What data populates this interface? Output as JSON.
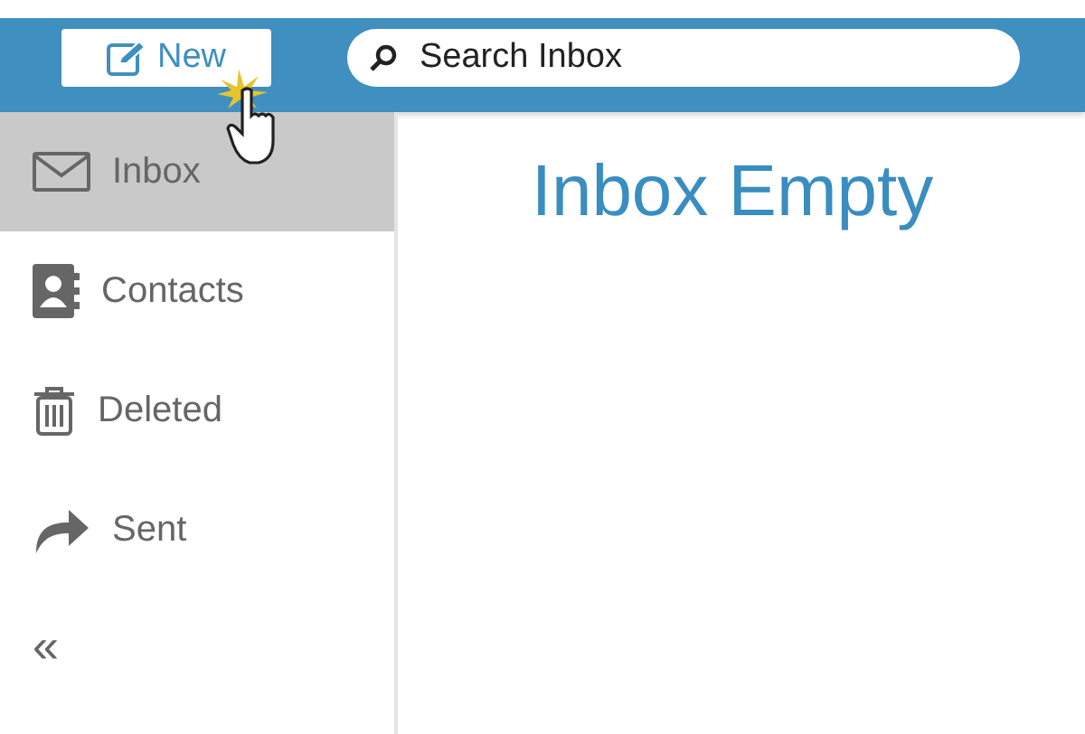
{
  "toolbar": {
    "new_button": "New",
    "search": {
      "placeholder": "Search Inbox"
    }
  },
  "sidebar": {
    "items": [
      {
        "label": "Inbox",
        "kind": "envelope",
        "selected": true
      },
      {
        "label": "Contacts",
        "kind": "contacts",
        "selected": false
      },
      {
        "label": "Deleted",
        "kind": "trash",
        "selected": false
      },
      {
        "label": "Sent",
        "kind": "forward",
        "selected": false
      }
    ],
    "collapse": "«"
  },
  "main": {
    "heading": "Inbox Empty"
  }
}
